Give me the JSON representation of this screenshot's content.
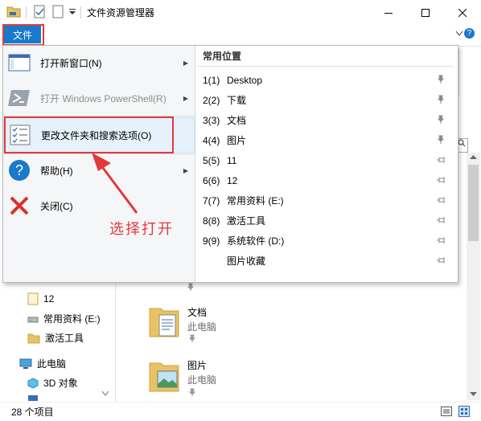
{
  "window": {
    "title": "文件资源管理器"
  },
  "ribbon": {
    "file_tab": "文件"
  },
  "file_menu": {
    "items": [
      {
        "label": "打开新窗口(N)",
        "disabled": false,
        "has_submenu": true
      },
      {
        "label": "打开 Windows PowerShell(R)",
        "disabled": true,
        "has_submenu": true
      },
      {
        "label": "更改文件夹和搜索选项(O)",
        "disabled": false,
        "has_submenu": false,
        "highlighted": true
      },
      {
        "label": "帮助(H)",
        "disabled": false,
        "has_submenu": true
      },
      {
        "label": "关闭(C)",
        "disabled": false,
        "has_submenu": false
      }
    ],
    "recent_title": "常用位置",
    "recent": [
      {
        "num": "1(1)",
        "name": "Desktop",
        "pinned": true
      },
      {
        "num": "2(2)",
        "name": "下载",
        "pinned": true
      },
      {
        "num": "3(3)",
        "name": "文档",
        "pinned": true
      },
      {
        "num": "4(4)",
        "name": "图片",
        "pinned": true
      },
      {
        "num": "5(5)",
        "name": "11",
        "pinned": false
      },
      {
        "num": "6(6)",
        "name": "12",
        "pinned": false
      },
      {
        "num": "7(7)",
        "name": "常用资料 (E:)",
        "pinned": false
      },
      {
        "num": "8(8)",
        "name": "激活工具",
        "pinned": false
      },
      {
        "num": "9(9)",
        "name": "系统软件 (D:)",
        "pinned": false
      },
      {
        "num": "",
        "name": "图片收藏",
        "pinned": false
      }
    ]
  },
  "annotation": "选择打开",
  "nav": [
    {
      "label": "12"
    },
    {
      "label": "常用资料 (E:)"
    },
    {
      "label": "激活工具"
    },
    {
      "label": "此电脑"
    },
    {
      "label": "3D 对象"
    }
  ],
  "content": [
    {
      "name": "文档",
      "sub": "此电脑"
    },
    {
      "name": "图片",
      "sub": "此电脑"
    }
  ],
  "status": {
    "count": "28 个项目"
  },
  "colors": {
    "accent": "#1979ca",
    "annotation": "#e4393b",
    "folder": "#e8c265"
  }
}
